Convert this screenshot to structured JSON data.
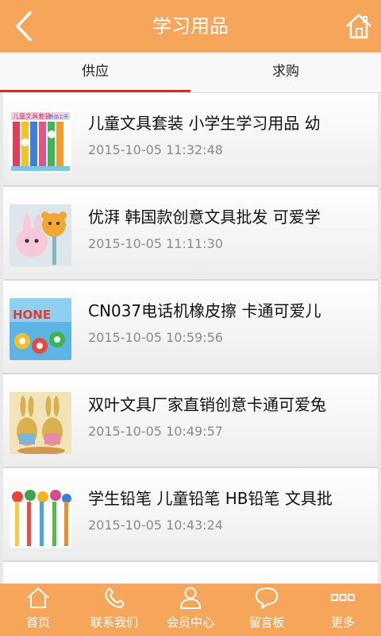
{
  "header": {
    "title": "学习用品",
    "back_icon": "back-chevron-icon",
    "home_icon": "home-icon"
  },
  "tabs": [
    {
      "label": "供应"
    },
    {
      "label": "求购"
    }
  ],
  "items": [
    {
      "title": "儿童文具套装 小学生学习用品 幼",
      "time": "2015-10-05 11:32:48",
      "thumb_text": [
        "儿童文具套装",
        "新品上市"
      ]
    },
    {
      "title": "优湃 韩国款创意文具批发 可爱学",
      "time": "2015-10-05 11:11:30"
    },
    {
      "title": "CN037电话机橡皮擦 卡通可爱儿",
      "time": "2015-10-05 10:59:56",
      "thumb_text": [
        "HONE"
      ]
    },
    {
      "title": "双叶文具厂家直销创意卡通可爱兔",
      "time": "2015-10-05 10:49:57"
    },
    {
      "title": "学生铅笔 儿童铅笔 HB铅笔 文具批",
      "time": "2015-10-05 10:43:24"
    }
  ],
  "bottom_nav": [
    {
      "label": "首页",
      "icon": "home-icon"
    },
    {
      "label": "联系我们",
      "icon": "phone-icon"
    },
    {
      "label": "会员中心",
      "icon": "user-icon"
    },
    {
      "label": "留言板",
      "icon": "chat-bubble-icon"
    },
    {
      "label": "更多",
      "icon": "more-icon"
    }
  ],
  "colors": {
    "accent": "#f5a65a",
    "tab_underline": "#c9312c"
  }
}
